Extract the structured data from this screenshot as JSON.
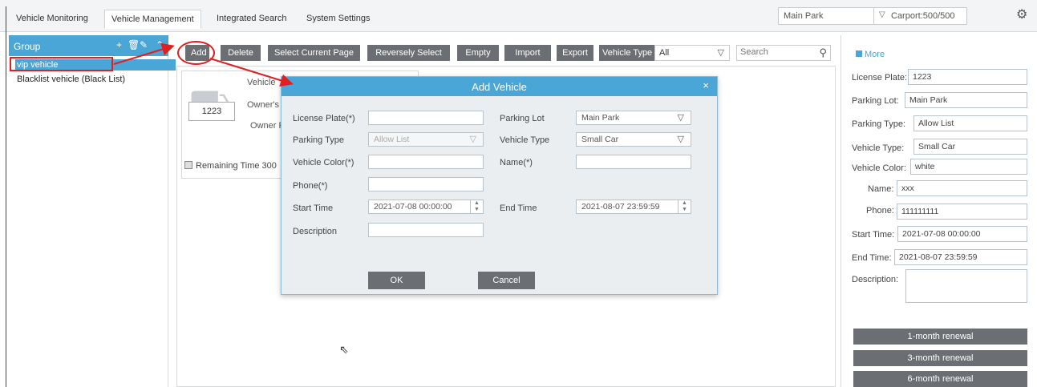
{
  "tabs": [
    {
      "label": "Vehicle Monitoring",
      "active": false
    },
    {
      "label": "Vehicle Management",
      "active": true
    },
    {
      "label": "Integrated Search",
      "active": false
    },
    {
      "label": "System Settings",
      "active": false
    }
  ],
  "park_select": {
    "value": "Main Park",
    "carport": "Carport:500/500"
  },
  "group": {
    "title": "Group",
    "items": [
      "vip vehicle",
      "Blacklist vehicle (Black List)"
    ]
  },
  "toolbar": {
    "buttons": [
      "Add",
      "Delete",
      "Select Current Page",
      "Reversely Select",
      "Empty",
      "Import",
      "Export"
    ],
    "vehicle_type_label": "Vehicle Type",
    "vehicle_type_value": "All",
    "search_placeholder": "Search"
  },
  "card": {
    "plate": "1223",
    "labels": [
      "Vehicle",
      "Owner's",
      "Owner P"
    ],
    "remaining": "Remaining Time 300"
  },
  "modal": {
    "title": "Add Vehicle",
    "close": "×",
    "fields": {
      "license_plate": {
        "label": "License Plate(*)",
        "value": ""
      },
      "parking_lot": {
        "label": "Parking Lot",
        "value": "Main Park"
      },
      "parking_type": {
        "label": "Parking Type",
        "value": "Allow List"
      },
      "vehicle_type": {
        "label": "Vehicle Type",
        "value": "Small Car"
      },
      "vehicle_color": {
        "label": "Vehicle Color(*)",
        "value": ""
      },
      "name": {
        "label": "Name(*)",
        "value": ""
      },
      "phone": {
        "label": "Phone(*)",
        "value": ""
      },
      "start_time": {
        "label": "Start Time",
        "value": "2021-07-08 00:00:00"
      },
      "end_time": {
        "label": "End Time",
        "value": "2021-08-07 23:59:59"
      },
      "description": {
        "label": "Description",
        "value": ""
      }
    },
    "ok": "OK",
    "cancel": "Cancel"
  },
  "details": {
    "more": "More",
    "fields": [
      {
        "label": "License Plate:",
        "value": "1223"
      },
      {
        "label": "Parking Lot:",
        "value": "Main Park"
      },
      {
        "label": "Parking Type:",
        "value": "Allow List"
      },
      {
        "label": "Vehicle Type:",
        "value": "Small Car"
      },
      {
        "label": "Vehicle Color:",
        "value": "white"
      },
      {
        "label": "Name:",
        "value": "xxx"
      },
      {
        "label": "Phone:",
        "value": "111111111"
      },
      {
        "label": "Start Time:",
        "value": "2021-07-08 00:00:00"
      },
      {
        "label": "End Time:",
        "value": "2021-08-07 23:59:59"
      },
      {
        "label": "Description:",
        "value": ""
      }
    ],
    "renewals": [
      "1-month renewal",
      "3-month renewal",
      "6-month renewal"
    ]
  },
  "colors": {
    "accent": "#4aa6d6",
    "button": "#6b6e72",
    "annotation": "#e02020"
  }
}
